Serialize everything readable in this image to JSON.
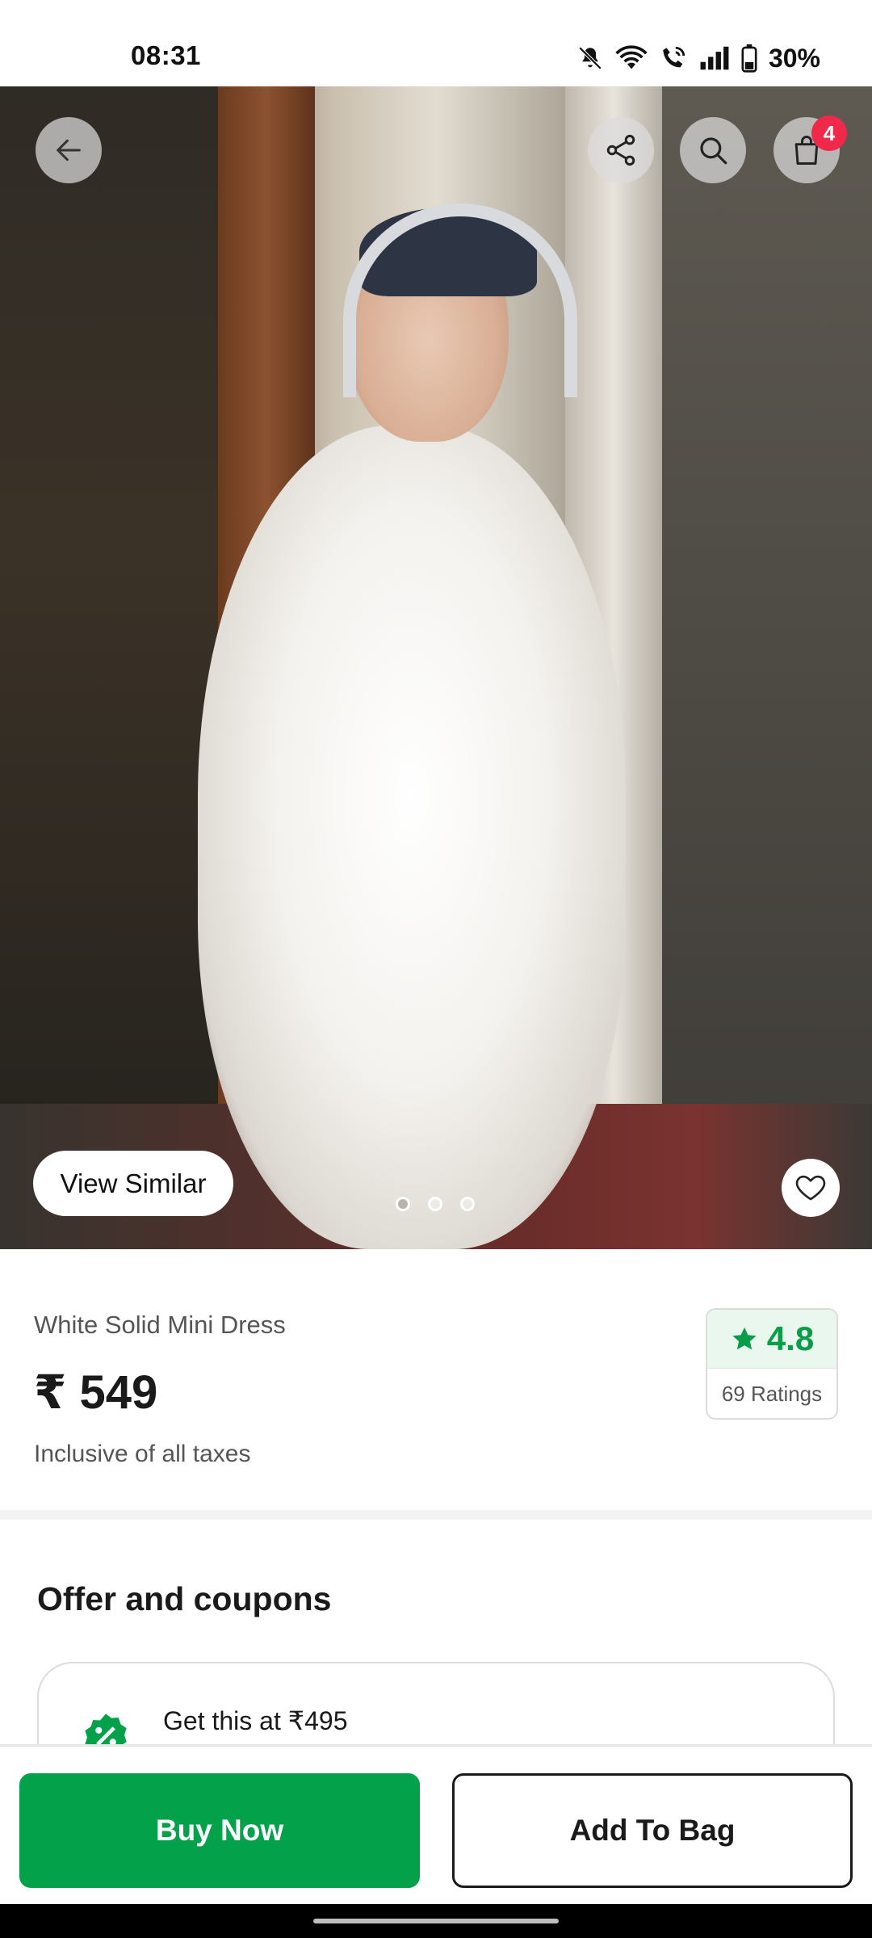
{
  "status_bar": {
    "time": "08:31",
    "battery": "30%",
    "icons": [
      "mute-icon",
      "wifi-icon",
      "wifi-call-icon",
      "signal-icon",
      "battery-icon"
    ]
  },
  "header": {
    "icons": [
      "back-arrow-icon",
      "share-icon",
      "search-icon",
      "bag-icon"
    ],
    "bag_count": "4"
  },
  "gallery": {
    "view_similar_label": "View Similar",
    "image_count": 3,
    "active_index": 1,
    "wishlist_icon": "heart-icon"
  },
  "product": {
    "name": "White Solid Mini Dress",
    "price": "₹ 549",
    "tax_note": "Inclusive of all taxes",
    "rating": {
      "value": "4.8",
      "count_label": "69 Ratings",
      "star_icon": "star-icon",
      "color": "#079d49"
    }
  },
  "offers": {
    "title": "Offer and coupons",
    "coupon": {
      "icon": "discount-badge-icon",
      "text": "Get this at ₹495"
    }
  },
  "actions": {
    "buy_now": "Buy Now",
    "add_to_bag": "Add To Bag",
    "primary_color": "#03a24a"
  }
}
